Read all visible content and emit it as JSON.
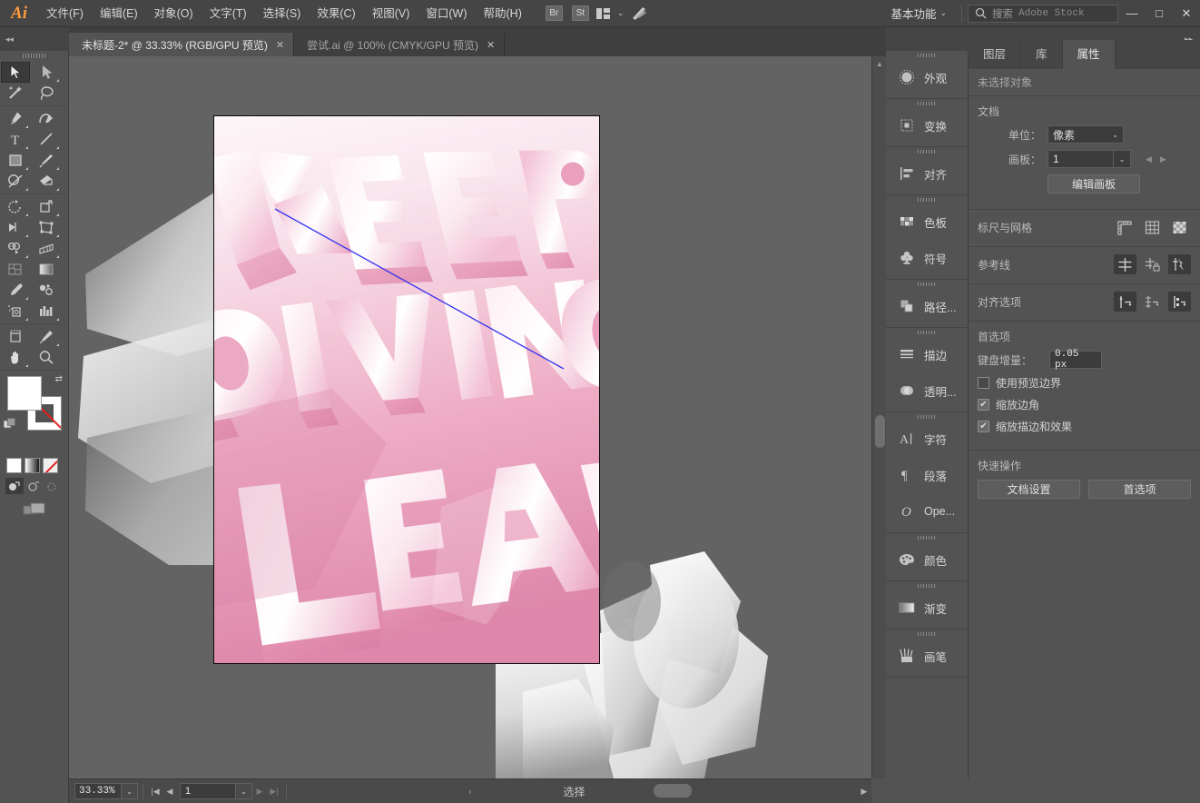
{
  "app": {
    "logo": "Ai",
    "menus": [
      {
        "label": "文件(F)",
        "name": "file"
      },
      {
        "label": "编辑(E)",
        "name": "edit"
      },
      {
        "label": "对象(O)",
        "name": "object"
      },
      {
        "label": "文字(T)",
        "name": "type"
      },
      {
        "label": "选择(S)",
        "name": "select"
      },
      {
        "label": "效果(C)",
        "name": "effect"
      },
      {
        "label": "视图(V)",
        "name": "view"
      },
      {
        "label": "窗口(W)",
        "name": "window"
      },
      {
        "label": "帮助(H)",
        "name": "help"
      }
    ],
    "bridge_label": "Br",
    "stock_label": "St",
    "workspace": "基本功能",
    "search_placeholder": "搜索",
    "search_brand": "Adobe Stock",
    "window_minimize": "—",
    "window_maximize": "□",
    "window_close": "✕",
    "collapse_left": "◂◂",
    "collapse_right": "▸▸"
  },
  "tabs": [
    {
      "label": "未标题-2* @ 33.33% (RGB/GPU 预览)",
      "close": "✕",
      "active": true
    },
    {
      "label": "尝试.ai @ 100% (CMYK/GPU 预览)",
      "close": "✕",
      "active": false
    }
  ],
  "toolbar": {
    "groups": [
      {
        "tools": [
          {
            "name": "selection-tool",
            "active": true,
            "flyout": false
          },
          {
            "name": "direct-selection-tool",
            "active": false,
            "flyout": true
          },
          {
            "name": "magic-wand-tool",
            "active": false,
            "flyout": false
          },
          {
            "name": "lasso-tool",
            "active": false,
            "flyout": false
          }
        ]
      },
      {
        "tools": [
          {
            "name": "pen-tool",
            "active": false,
            "flyout": true
          },
          {
            "name": "curvature-tool",
            "active": false,
            "flyout": false
          },
          {
            "name": "type-tool",
            "active": false,
            "flyout": true
          },
          {
            "name": "line-segment-tool",
            "active": false,
            "flyout": true
          },
          {
            "name": "rectangle-tool",
            "active": false,
            "flyout": true
          },
          {
            "name": "paintbrush-tool",
            "active": false,
            "flyout": true
          },
          {
            "name": "shaper-tool",
            "active": false,
            "flyout": true
          },
          {
            "name": "eraser-tool",
            "active": false,
            "flyout": true
          }
        ]
      },
      {
        "tools": [
          {
            "name": "rotate-tool",
            "active": false,
            "flyout": true
          },
          {
            "name": "scale-tool",
            "active": false,
            "flyout": true
          },
          {
            "name": "width-tool",
            "active": false,
            "flyout": true
          },
          {
            "name": "free-transform-tool",
            "active": false,
            "flyout": true
          },
          {
            "name": "shape-builder-tool",
            "active": false,
            "flyout": true
          },
          {
            "name": "perspective-grid-tool",
            "active": false,
            "flyout": true
          },
          {
            "name": "mesh-tool",
            "active": false,
            "flyout": false
          },
          {
            "name": "gradient-tool",
            "active": false,
            "flyout": false
          },
          {
            "name": "eyedropper-tool",
            "active": false,
            "flyout": true
          },
          {
            "name": "blend-tool",
            "active": false,
            "flyout": false
          },
          {
            "name": "symbol-sprayer-tool",
            "active": false,
            "flyout": true
          },
          {
            "name": "column-graph-tool",
            "active": false,
            "flyout": true
          }
        ]
      },
      {
        "tools": [
          {
            "name": "artboard-tool",
            "active": false,
            "flyout": false
          },
          {
            "name": "slice-tool",
            "active": false,
            "flyout": true
          },
          {
            "name": "hand-tool",
            "active": false,
            "flyout": true
          },
          {
            "name": "zoom-tool",
            "active": false,
            "flyout": false
          }
        ]
      }
    ],
    "fill_color": "#ffffff",
    "stroke_color": "#ffffff",
    "stroke_is_none": true,
    "swap_icon": "⇄",
    "mode_color_label": "color",
    "mode_gradient_label": "gradient",
    "mode_none_label": "none",
    "draw_modes": [
      "draw-normal",
      "draw-behind",
      "draw-inside"
    ],
    "screen_mode": "change-screen-mode"
  },
  "canvas": {
    "background_color": "#636363",
    "artboard": {
      "fill_top": "#fdf7f9",
      "fill_bottom": "#e292b2",
      "border_color": "#0c0c0c"
    },
    "artwork_text_lines": [
      "KEEP",
      "DIVING",
      "LEAR"
    ],
    "selection_path_color": "#3333ee"
  },
  "panel_dock": {
    "groups": [
      {
        "items": [
          {
            "label": "外观",
            "icon": "appearance-icon"
          }
        ]
      },
      {
        "items": [
          {
            "label": "变换",
            "icon": "transform-icon"
          }
        ]
      },
      {
        "items": [
          {
            "label": "对齐",
            "icon": "align-icon"
          }
        ]
      },
      {
        "items": [
          {
            "label": "色板",
            "icon": "swatches-icon"
          },
          {
            "label": "符号",
            "icon": "symbols-icon"
          }
        ]
      },
      {
        "items": [
          {
            "label": "路径...",
            "icon": "pathfinder-icon"
          }
        ]
      },
      {
        "items": [
          {
            "label": "描边",
            "icon": "stroke-icon"
          },
          {
            "label": "透明...",
            "icon": "transparency-icon"
          }
        ]
      },
      {
        "items": [
          {
            "label": "字符",
            "icon": "character-icon"
          },
          {
            "label": "段落",
            "icon": "paragraph-icon"
          },
          {
            "label": "Ope...",
            "icon": "opentype-icon"
          }
        ]
      },
      {
        "items": [
          {
            "label": "颜色",
            "icon": "color-icon"
          }
        ]
      },
      {
        "items": [
          {
            "label": "渐变",
            "icon": "gradient-icon"
          }
        ]
      },
      {
        "items": [
          {
            "label": "画笔",
            "icon": "brushes-icon"
          }
        ]
      }
    ]
  },
  "properties": {
    "tabs": [
      {
        "label": "图层",
        "active": false
      },
      {
        "label": "库",
        "active": false
      },
      {
        "label": "属性",
        "active": true
      }
    ],
    "no_selection": "未选择对象",
    "document": {
      "title": "文档",
      "units_label": "单位：",
      "units_value": "像素",
      "artboard_label": "画板：",
      "artboard_value": "1",
      "edit_artboards": "编辑画板",
      "prev_arrow": "◀",
      "next_arrow": "▶"
    },
    "rulers": {
      "title": "标尺与网格",
      "buttons": [
        "show-rulers-icon",
        "show-grid-icon",
        "show-transparency-grid-icon"
      ]
    },
    "guides": {
      "title": "参考线",
      "buttons": [
        "show-guides-icon",
        "lock-guides-icon",
        "smart-guides-icon"
      ]
    },
    "align_options": {
      "title": "对齐选项",
      "buttons": [
        "align-to-selection-icon",
        "align-to-key-object-icon",
        "align-to-artboard-icon"
      ]
    },
    "preferences": {
      "title": "首选项",
      "keyboard_increment_label": "键盘增量：",
      "keyboard_increment_value": "0.05 px",
      "checkboxes": [
        {
          "label": "使用预览边界",
          "checked": false
        },
        {
          "label": "缩放边角",
          "checked": true
        },
        {
          "label": "缩放描边和效果",
          "checked": true
        }
      ]
    },
    "quick_actions": {
      "title": "快速操作",
      "buttons": [
        "文档设置",
        "首选项"
      ]
    }
  },
  "statusbar": {
    "zoom_value": "33.33%",
    "zoom_dropdown": "⌄",
    "first_page": "|◀",
    "prev_page": "◀",
    "page_value": "1",
    "page_dropdown": "⌄",
    "next_page": "▶",
    "last_page": "▶|",
    "status_text": "选择",
    "status_arrow": "▶",
    "status_chevron": "‹",
    "hscroll_left": "‹",
    "hscroll_right": "›"
  }
}
